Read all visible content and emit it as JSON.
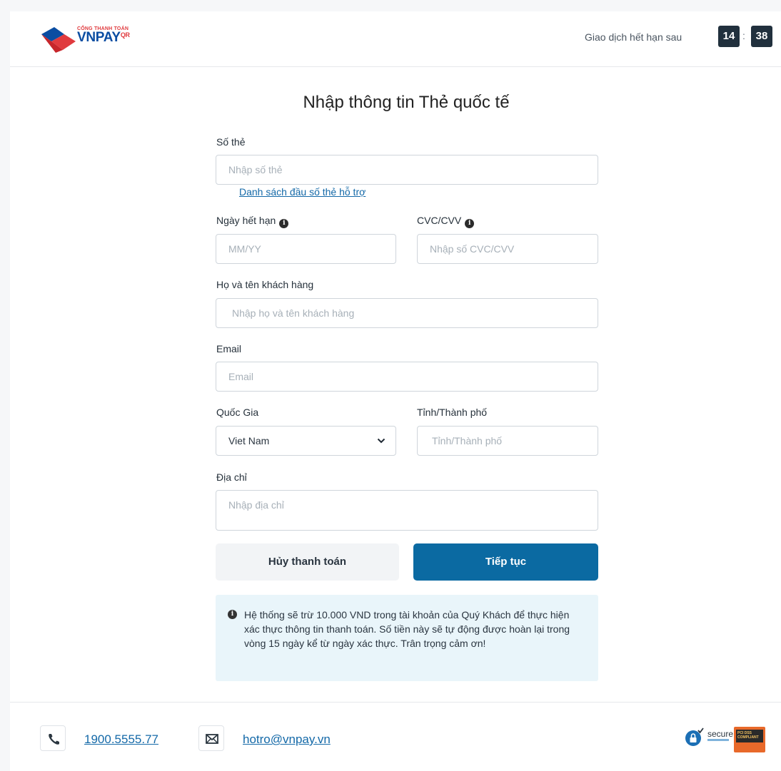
{
  "header": {
    "logo_small": "CỔNG THANH TOÁN",
    "logo_main": "VNPAY",
    "logo_qr": "QR",
    "timer_label": "Giao dịch hết hạn sau",
    "timer_minutes": "14",
    "timer_separator": ":",
    "timer_seconds": "38"
  },
  "form": {
    "title": "Nhập thông tin Thẻ quốc tế",
    "card_number": {
      "label": "Số thẻ",
      "placeholder": "Nhập số thẻ",
      "value": ""
    },
    "supported_bins_link": "Danh sách đầu số thẻ hỗ trợ",
    "expiry": {
      "label": "Ngày hết hạn",
      "placeholder": "MM/YY",
      "value": ""
    },
    "cvc": {
      "label": "CVC/CVV",
      "placeholder": "Nhập số CVC/CVV",
      "value": ""
    },
    "full_name": {
      "label": "Họ và tên khách hàng",
      "placeholder": "Nhập họ và tên khách hàng",
      "value": ""
    },
    "email": {
      "label": "Email",
      "placeholder": "Email",
      "value": ""
    },
    "country": {
      "label": "Quốc Gia",
      "selected": "Viet Nam"
    },
    "city": {
      "label": "Tỉnh/Thành phố",
      "placeholder": "Tỉnh/Thành phố",
      "value": ""
    },
    "address": {
      "label": "Địa chỉ",
      "placeholder": "Nhập địa chỉ",
      "value": ""
    },
    "cancel_label": "Hủy thanh toán",
    "continue_label": "Tiếp tục",
    "notice": "Hệ thống sẽ trừ 10.000 VND trong tài khoản của Quý Khách để thực hiện xác thực thông tin thanh toán. Số tiền này sẽ tự động được hoàn lại trong vòng 15 ngày kể từ ngày xác thực. Trân trọng cảm ơn!"
  },
  "footer": {
    "phone": "1900.5555.77",
    "email": "hotro@vnpay.vn",
    "badge_secure": "secure",
    "badge_pci": "PCI DSS COMPLIANT"
  },
  "colors": {
    "primary": "#0b6aa2",
    "brand_red": "#e03a3e",
    "brand_blue": "#0a4da2",
    "timer_bg": "#21303d",
    "notice_bg": "#e9f5fa"
  },
  "icons": [
    "vnpay-logo",
    "info-icon",
    "chevron-down-icon",
    "phone-icon",
    "mail-icon",
    "secure-lock-icon",
    "pci-badge-icon"
  ]
}
